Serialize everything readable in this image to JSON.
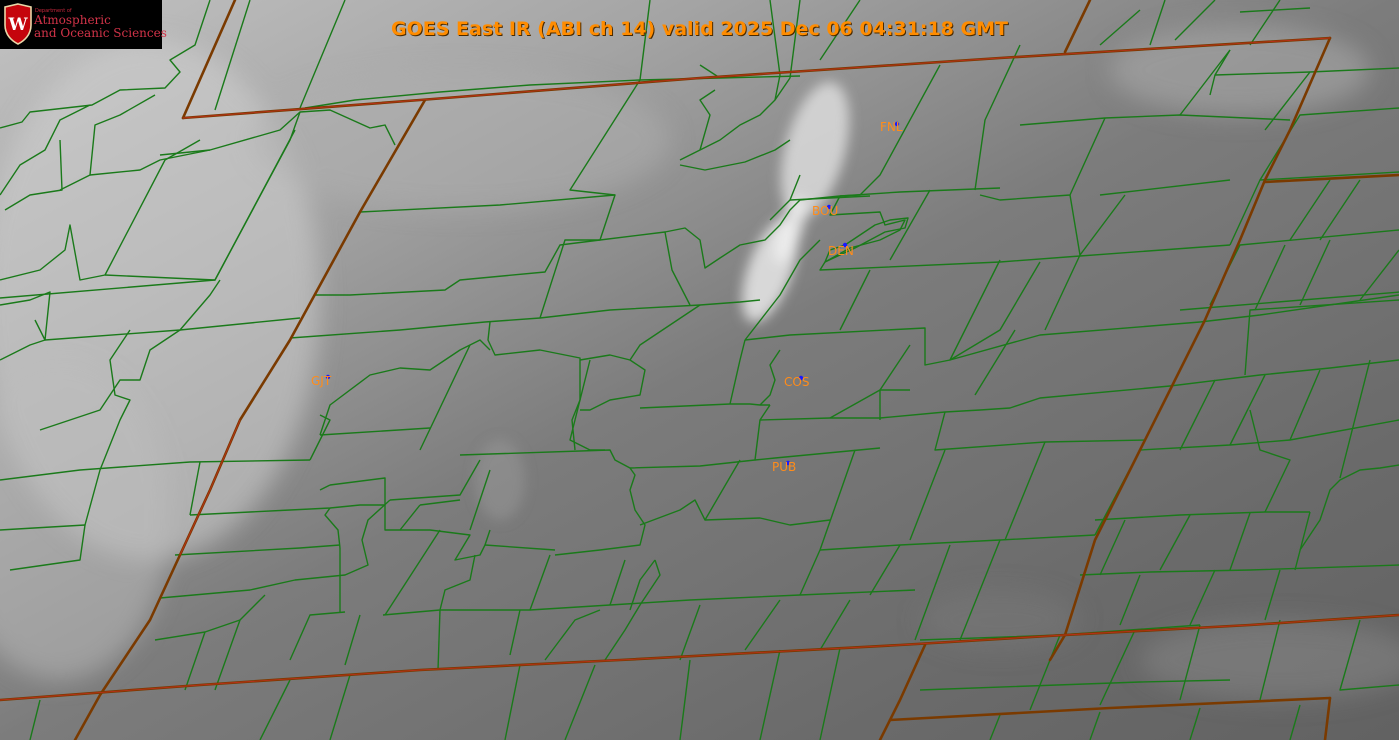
{
  "title": "GOES East IR (ABI ch 14) valid 2025 Dec 06 04:31:18 GMT",
  "logo": {
    "department": "Department of",
    "line1": "Atmospheric",
    "line2": "and Oceanic Sciences",
    "shield_letter": "W"
  },
  "stations": [
    {
      "id": "FNL",
      "label": "FNL"
    },
    {
      "id": "BOU",
      "label": "BOU"
    },
    {
      "id": "DEN",
      "label": "DEN"
    },
    {
      "id": "COS",
      "label": "COS"
    },
    {
      "id": "PUB",
      "label": "PUB"
    },
    {
      "id": "GJT",
      "label": "GJT"
    }
  ],
  "colors": {
    "county_lines": "#1a7a1a",
    "state_lines": "#7a3a00",
    "state_line_highlight": "#c0301a",
    "title_text": "#ff8c00",
    "station_text": "#ff8c1a",
    "station_marker": "#1a1aff",
    "logo_red": "#c8283d"
  }
}
